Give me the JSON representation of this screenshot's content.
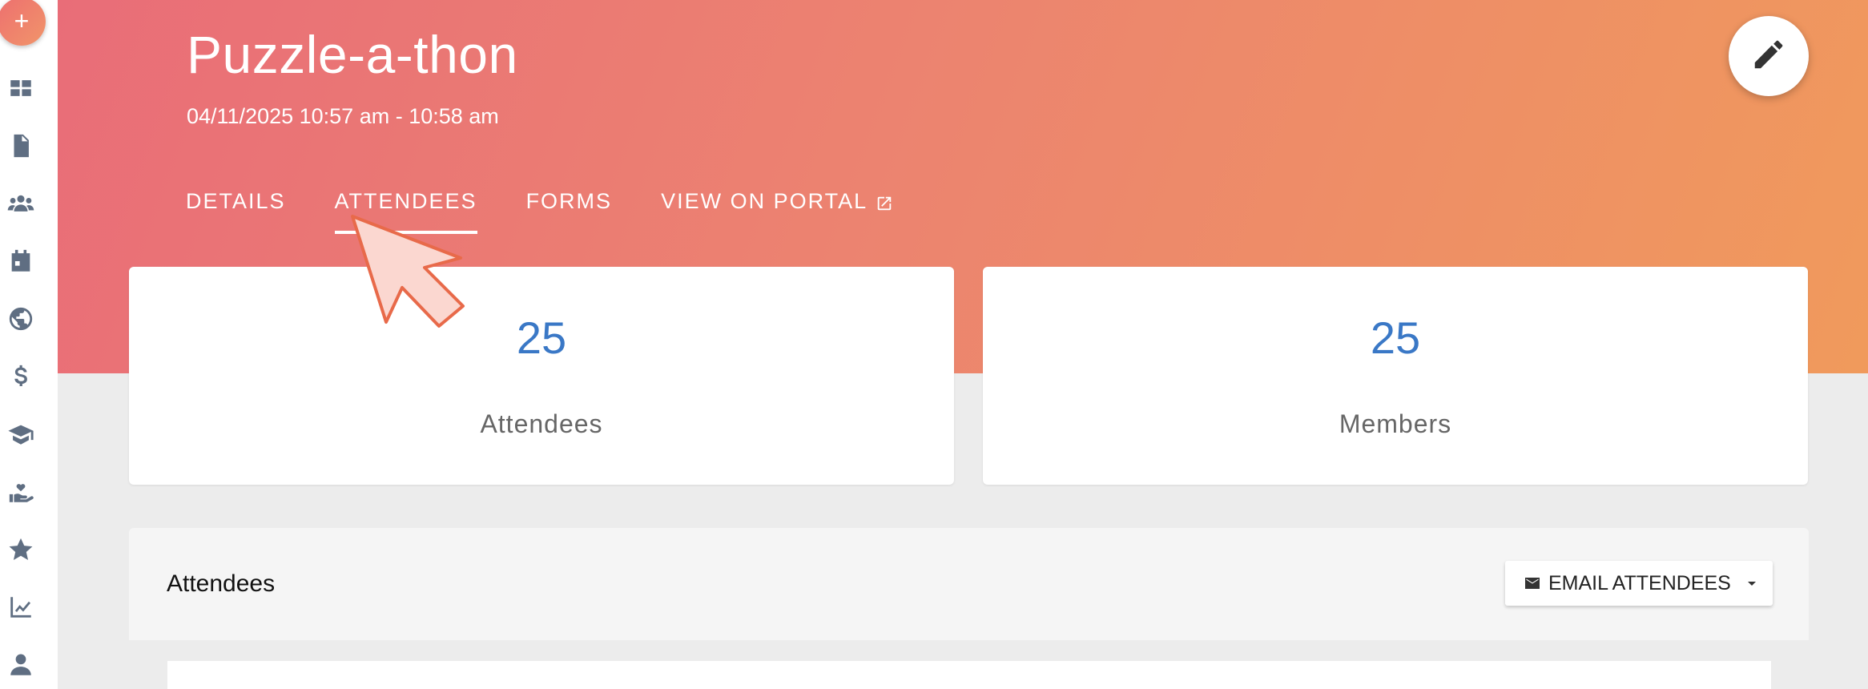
{
  "sidebar": {
    "add_label": "+",
    "items": [
      {
        "icon": "dashboard-icon"
      },
      {
        "icon": "document-icon"
      },
      {
        "icon": "people-icon"
      },
      {
        "icon": "calendar-icon"
      },
      {
        "icon": "globe-icon"
      },
      {
        "icon": "dollar-icon"
      },
      {
        "icon": "graduation-cap-icon"
      },
      {
        "icon": "hand-heart-icon"
      },
      {
        "icon": "star-icon"
      },
      {
        "icon": "chart-line-icon"
      },
      {
        "icon": "person-icon"
      }
    ]
  },
  "header": {
    "title": "Puzzle-a-thon",
    "subtitle": "04/11/2025 10:57 am - 10:58 am",
    "tabs": [
      {
        "label": "DETAILS"
      },
      {
        "label": "ATTENDEES",
        "active": true
      },
      {
        "label": "FORMS"
      },
      {
        "label": "VIEW ON PORTAL"
      }
    ]
  },
  "stats": {
    "attendees": {
      "value": "25",
      "label": "Attendees"
    },
    "members": {
      "value": "25",
      "label": "Members"
    }
  },
  "panel": {
    "title": "Attendees",
    "email_button": "EMAIL ATTENDEES"
  },
  "colors": {
    "gradient_start": "#e96d78",
    "gradient_end": "#f09a5c",
    "stat_value": "#3a78c6",
    "sidebar_icon": "#5f6e82"
  }
}
